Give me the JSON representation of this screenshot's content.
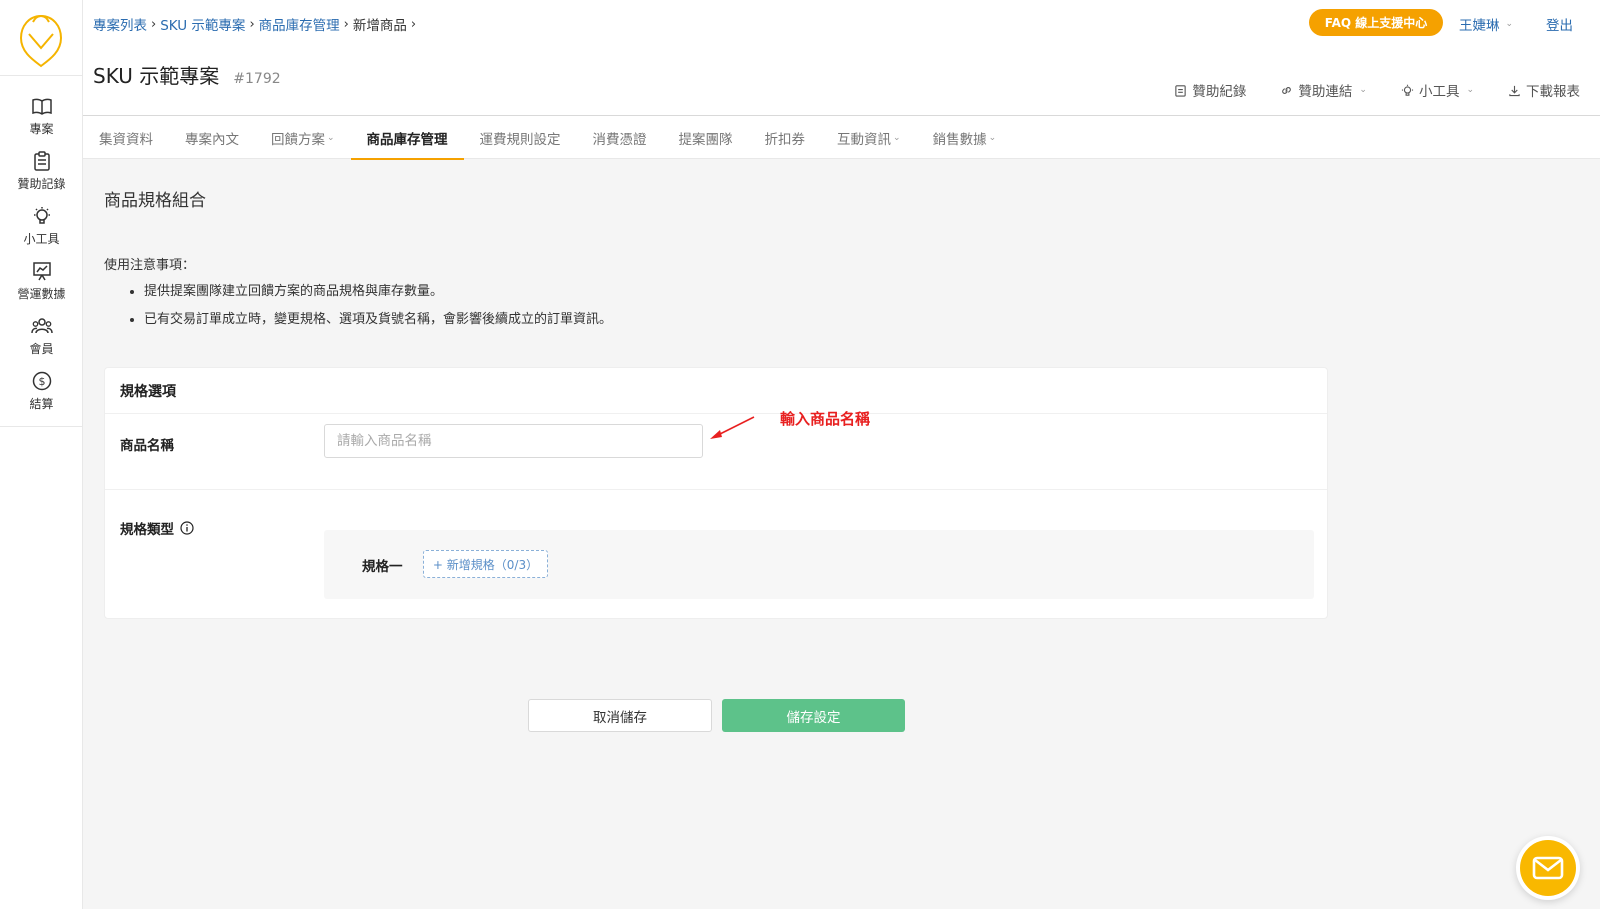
{
  "colors": {
    "accent": "#f5a100",
    "link": "#2b6cb0",
    "save": "#5dc28a",
    "annotation": "#e82020"
  },
  "sidebar": {
    "items": [
      {
        "label": "專案",
        "icon": "book-icon"
      },
      {
        "label": "贊助記錄",
        "icon": "clipboard-icon"
      },
      {
        "label": "小工具",
        "icon": "lightbulb-icon"
      },
      {
        "label": "營運數據",
        "icon": "chart-board-icon"
      },
      {
        "label": "會員",
        "icon": "members-icon"
      },
      {
        "label": "結算",
        "icon": "dollar-icon"
      }
    ]
  },
  "breadcrumb": {
    "items": [
      {
        "label": "專案列表",
        "link": true
      },
      {
        "label": "SKU 示範專案",
        "link": true
      },
      {
        "label": "商品庫存管理",
        "link": true
      },
      {
        "label": "新增商品",
        "link": false
      }
    ]
  },
  "header": {
    "faq_label": "FAQ 線上支援中心",
    "user_name": "王婕琳",
    "logout_label": "登出",
    "project_title": "SKU 示範專案",
    "project_id": "#1792",
    "toolbar": {
      "sponsor_records": "贊助紀錄",
      "sponsor_links": "贊助連結",
      "tools": "小工具",
      "download_report": "下載報表"
    }
  },
  "tabs": [
    {
      "label": "集資資料",
      "dropdown": false,
      "active": false
    },
    {
      "label": "專案內文",
      "dropdown": false,
      "active": false
    },
    {
      "label": "回饋方案",
      "dropdown": true,
      "active": false
    },
    {
      "label": "商品庫存管理",
      "dropdown": false,
      "active": true
    },
    {
      "label": "運費規則設定",
      "dropdown": false,
      "active": false
    },
    {
      "label": "消費憑證",
      "dropdown": false,
      "active": false
    },
    {
      "label": "提案團隊",
      "dropdown": false,
      "active": false
    },
    {
      "label": "折扣券",
      "dropdown": false,
      "active": false
    },
    {
      "label": "互動資訊",
      "dropdown": true,
      "active": false
    },
    {
      "label": "銷售數據",
      "dropdown": true,
      "active": false
    }
  ],
  "main": {
    "section_title": "商品規格組合",
    "notice_title": "使用注意事項：",
    "notices": [
      "提供提案團隊建立回饋方案的商品規格與庫存數量。",
      "已有交易訂單成立時，變更規格、選項及貨號名稱，會影響後續成立的訂單資訊。"
    ],
    "card": {
      "title": "規格選項",
      "name_label": "商品名稱",
      "name_placeholder": "請輸入商品名稱",
      "name_value": "",
      "spec_type_label": "規格類型",
      "spec_one_label": "規格一",
      "add_spec_label": "+ 新增規格（0/3）"
    },
    "annotation": "輸入商品名稱",
    "cancel_label": "取消儲存",
    "save_label": "儲存設定"
  }
}
